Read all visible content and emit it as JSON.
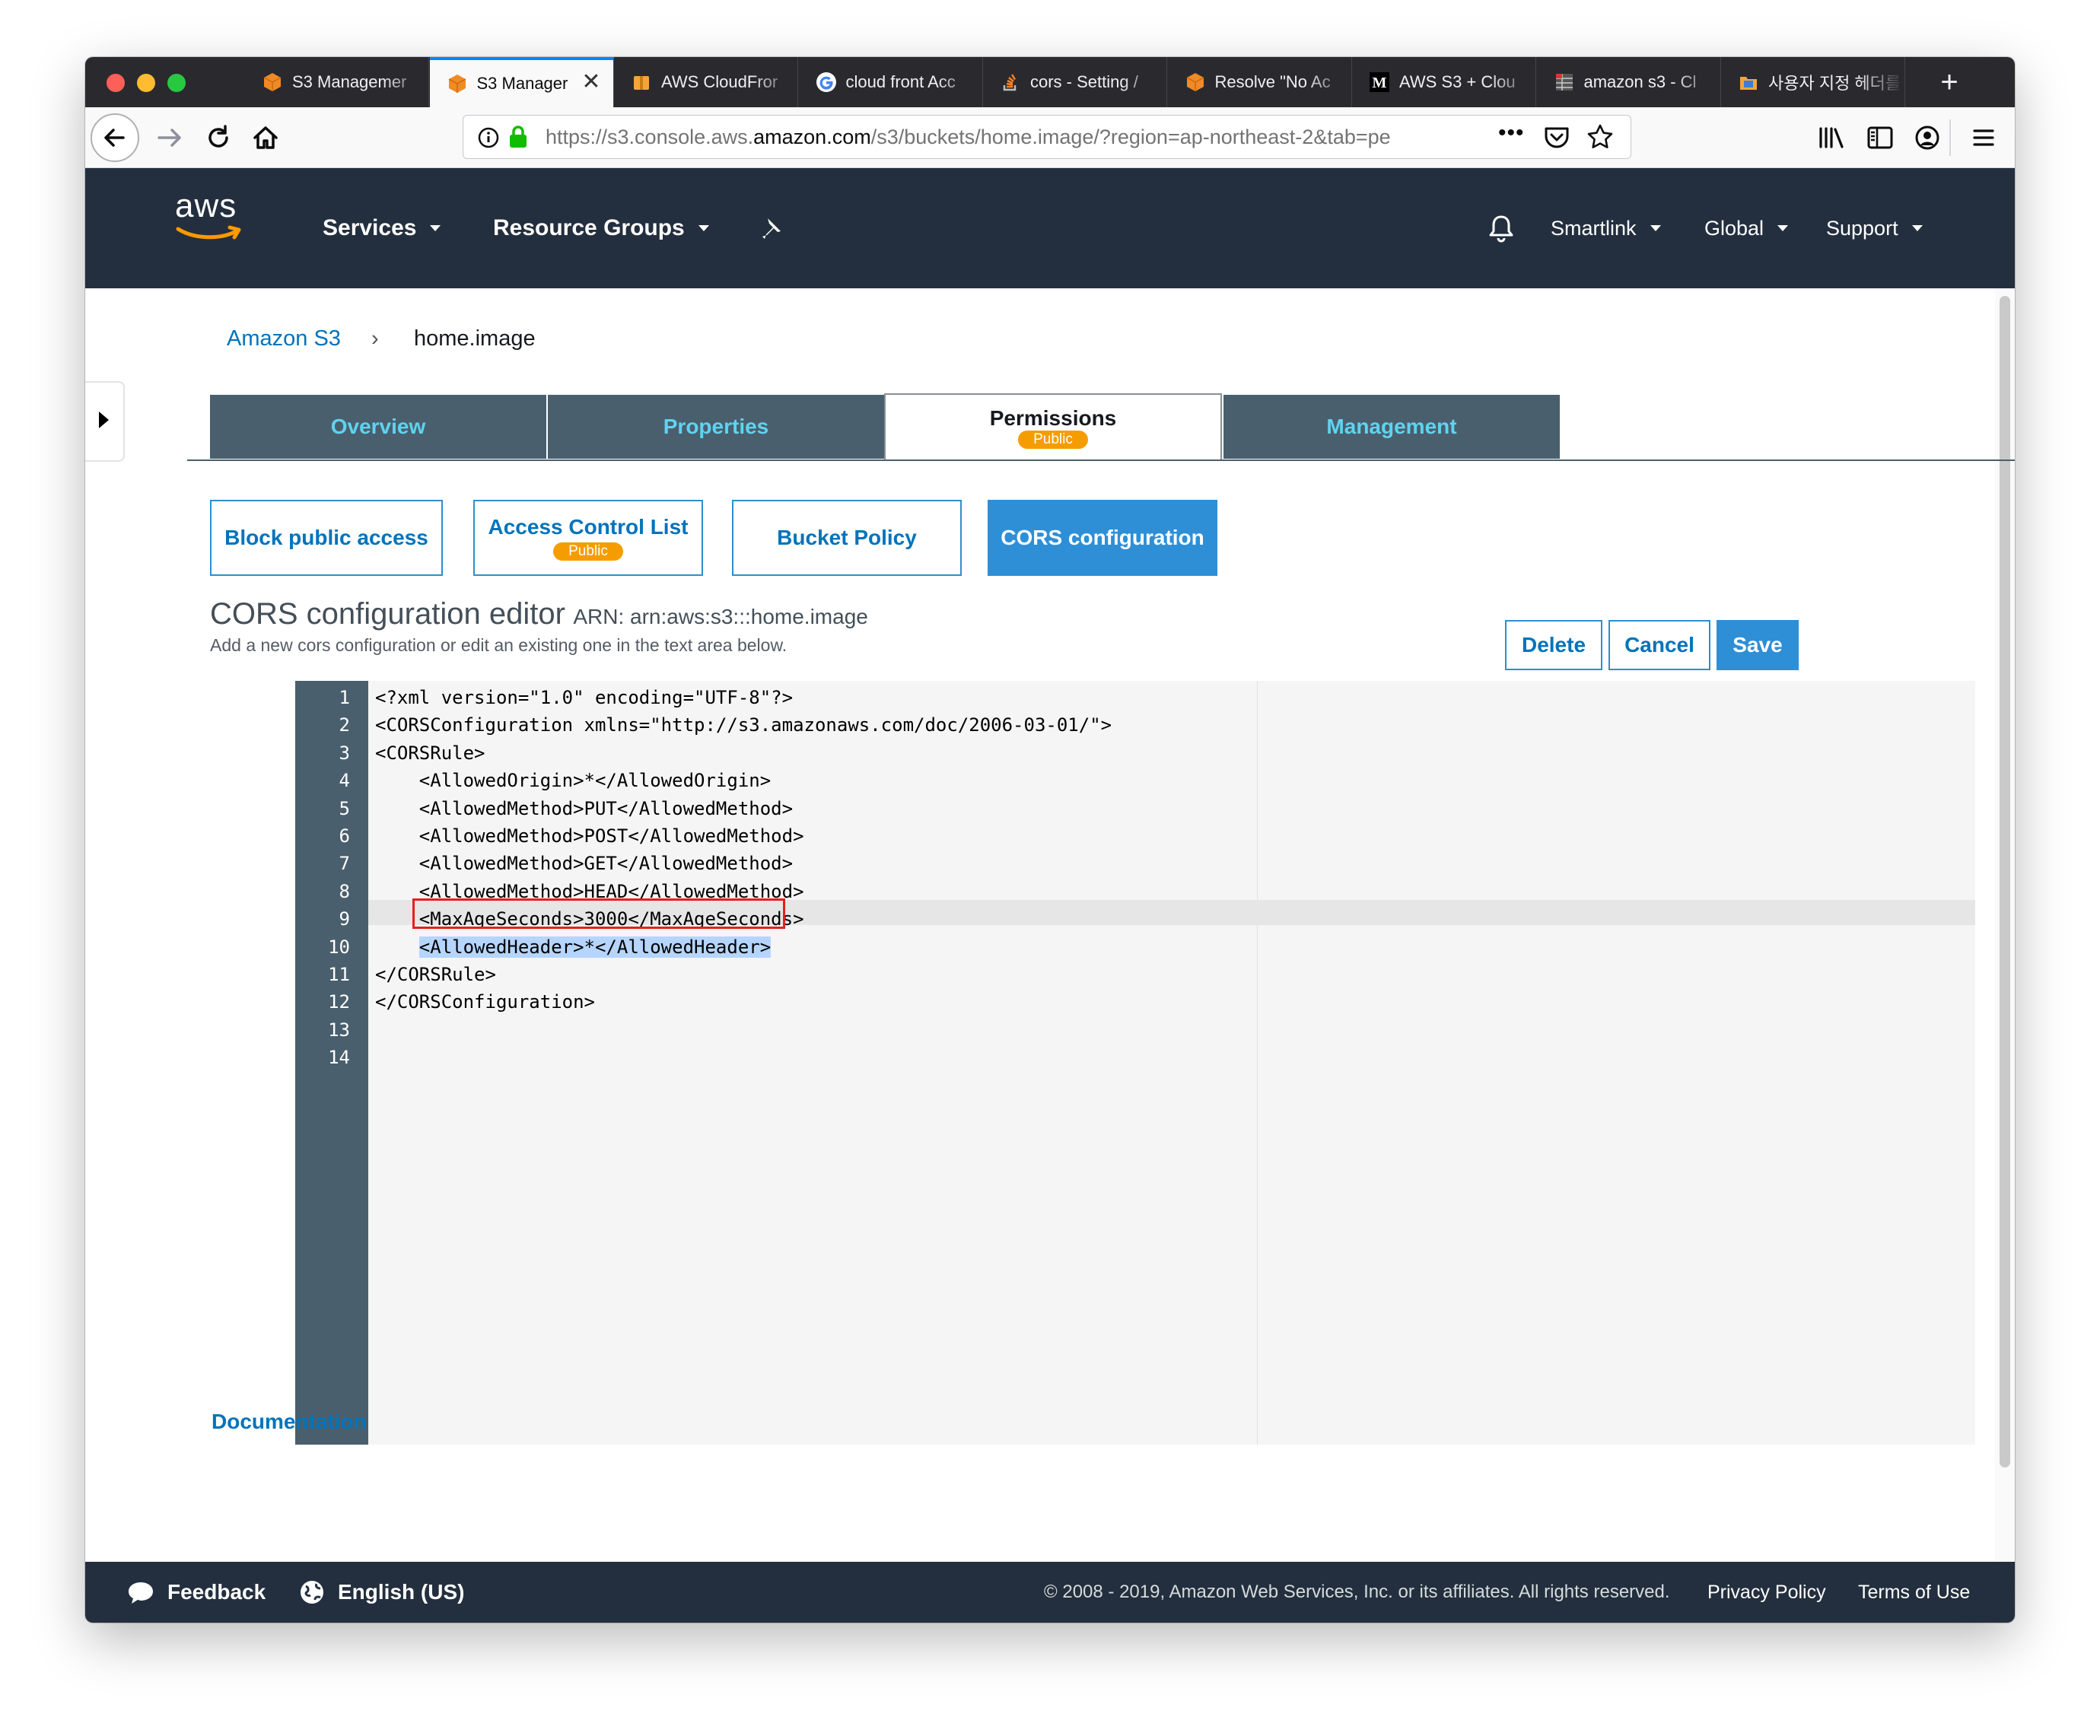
{
  "browser": {
    "tabs": [
      {
        "title": "S3 Managemer",
        "favicon": "aws-box-icon",
        "active": false
      },
      {
        "title": "S3 Manager",
        "favicon": "aws-box-icon",
        "active": true
      },
      {
        "title": "AWS CloudFror",
        "favicon": "aws-package-icon",
        "active": false
      },
      {
        "title": "cloud front Acc",
        "favicon": "google-g-icon",
        "active": false
      },
      {
        "title": "cors - Setting /",
        "favicon": "stackoverflow-icon",
        "active": false
      },
      {
        "title": "Resolve \"No Ac",
        "favicon": "aws-box-icon",
        "active": false
      },
      {
        "title": "AWS S3 + Clou",
        "favicon": "medium-m-icon",
        "active": false
      },
      {
        "title": "amazon s3 - Cl",
        "favicon": "dark-grid-icon",
        "active": false
      },
      {
        "title": "사용자 지정 헤더를",
        "favicon": "aws-folder-icon",
        "active": false
      }
    ],
    "new_tab_label": "+",
    "url": {
      "prefix": "https://s3.console.aws.",
      "host": "amazon.com",
      "path": "/s3/buckets/home.image/?region=ap-northeast-2&tab=pe"
    },
    "page_actions": "•••"
  },
  "aws_header": {
    "logo": "aws",
    "services": "Services",
    "resource_groups": "Resource Groups",
    "account": "Smartlink",
    "region": "Global",
    "support": "Support"
  },
  "breadcrumb": {
    "root": "Amazon S3",
    "separator": "›",
    "current": "home.image"
  },
  "tabs": {
    "overview": "Overview",
    "properties": "Properties",
    "permissions": "Permissions",
    "permissions_badge": "Public",
    "management": "Management"
  },
  "subtabs": {
    "block_public_access": "Block public access",
    "acl": "Access Control List",
    "acl_badge": "Public",
    "bucket_policy": "Bucket Policy",
    "cors": "CORS configuration"
  },
  "editor_section": {
    "title": "CORS configuration editor",
    "arn_label": "ARN: arn:aws:s3:::home.image",
    "description": "Add a new cors configuration or edit an existing one in the text area below.",
    "delete": "Delete",
    "cancel": "Cancel",
    "save": "Save"
  },
  "code_lines": [
    {
      "n": "1",
      "text": "<?xml version=\"1.0\" encoding=\"UTF-8\"?>"
    },
    {
      "n": "2",
      "text": "<CORSConfiguration xmlns=\"http://s3.amazonaws.com/doc/2006-03-01/\">"
    },
    {
      "n": "3",
      "text": "<CORSRule>"
    },
    {
      "n": "4",
      "text": "    <AllowedOrigin>*</AllowedOrigin>"
    },
    {
      "n": "5",
      "text": "    <AllowedMethod>PUT</AllowedMethod>"
    },
    {
      "n": "6",
      "text": "    <AllowedMethod>POST</AllowedMethod>"
    },
    {
      "n": "7",
      "text": "    <AllowedMethod>GET</AllowedMethod>"
    },
    {
      "n": "8",
      "text": "    <AllowedMethod>HEAD</AllowedMethod>"
    },
    {
      "n": "9",
      "text": "    <MaxAgeSeconds>3000</MaxAgeSeconds>"
    },
    {
      "n": "10",
      "text": "    <AllowedHeader>*</AllowedHeader>",
      "highlighted": true
    },
    {
      "n": "11",
      "text": "</CORSRule>"
    },
    {
      "n": "12",
      "text": "</CORSConfiguration>"
    },
    {
      "n": "13",
      "text": ""
    },
    {
      "n": "14",
      "text": ""
    }
  ],
  "documentation_link": "Documentation",
  "footer": {
    "feedback": "Feedback",
    "language": "English (US)",
    "copyright": "© 2008 - 2019, Amazon Web Services, Inc. or its affiliates. All rights reserved.",
    "privacy": "Privacy Policy",
    "terms": "Terms of Use"
  },
  "colors": {
    "aws_header": "#232f3e",
    "tab_dark": "#4a5f6d",
    "tab_text": "#5fd3f0",
    "link_blue": "#0073bb",
    "primary_blue": "#2e8fd6",
    "badge_orange": "#f59d00",
    "highlight_red": "#e5201c"
  }
}
